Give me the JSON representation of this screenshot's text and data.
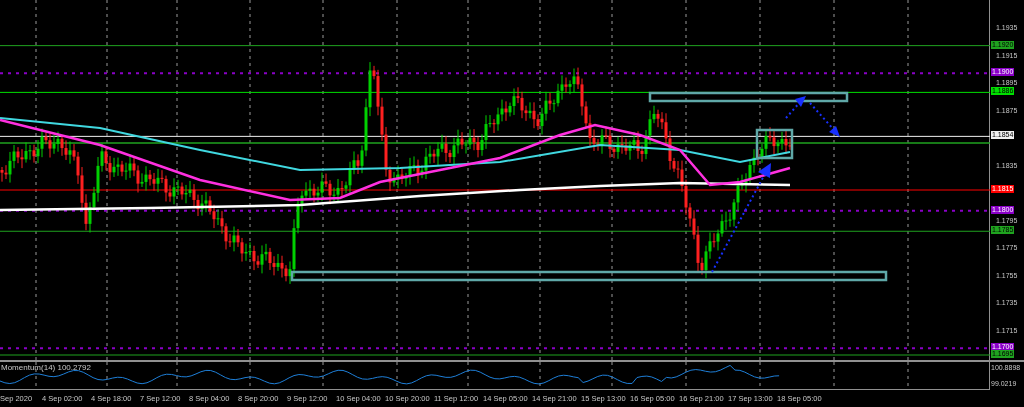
{
  "price_axis": {
    "ticks": [
      "1.1935",
      "1.1915",
      "1.1895",
      "1.1875",
      "1.1835",
      "1.1795",
      "1.1775",
      "1.1755",
      "1.1735",
      "1.1715"
    ]
  },
  "levels": [
    {
      "price": "1.1920",
      "color": "#1fa31f",
      "kind": "solid"
    },
    {
      "price": "1.1900",
      "color": "#8a00c8",
      "kind": "dotted"
    },
    {
      "price": "1.1886",
      "color": "#00e000",
      "kind": "solid"
    },
    {
      "price": "1.1854",
      "color": "#f0f0f0",
      "kind": "solid"
    },
    {
      "price": "1.1815",
      "color": "#ff0000",
      "kind": "solid"
    },
    {
      "price": "1.1800",
      "color": "#8a00c8",
      "kind": "dotted"
    },
    {
      "price": "1.1785",
      "color": "#1fa31f",
      "kind": "solid"
    },
    {
      "price": "1.1700",
      "color": "#8a00c8",
      "kind": "dotted"
    },
    {
      "price": "1.1695",
      "color": "#1fa31f",
      "kind": "solid"
    }
  ],
  "indicator": {
    "label": "Momentum(14) 100.2792",
    "scale": [
      "100.8898",
      "99.0219"
    ]
  },
  "time_axis": [
    "Sep 2020",
    "4 Sep 02:00",
    "4 Sep 18:00",
    "7 Sep 12:00",
    "8 Sep 04:00",
    "8 Sep 20:00",
    "9 Sep 12:00",
    "10 Sep 04:00",
    "10 Sep 20:00",
    "11 Sep 12:00",
    "14 Sep 05:00",
    "14 Sep 21:00",
    "15 Sep 13:00",
    "16 Sep 05:00",
    "16 Sep 21:00",
    "17 Sep 13:00",
    "18 Sep 05:00"
  ]
}
